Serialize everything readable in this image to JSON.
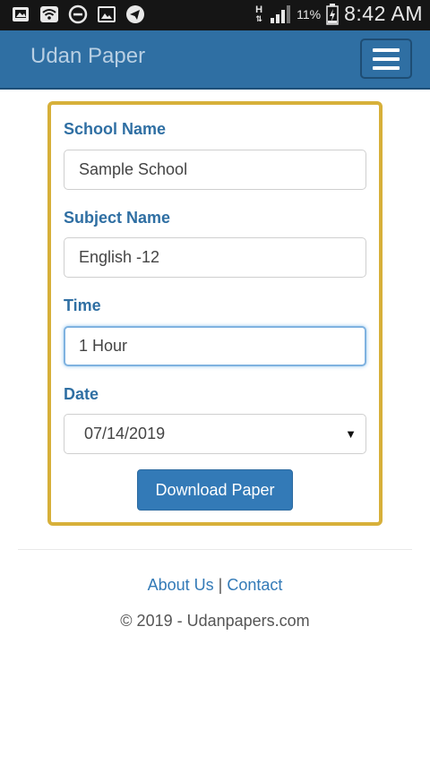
{
  "status_bar": {
    "left_icons": [
      "gallery-notification-icon",
      "wifi-icon",
      "do-not-disturb-icon",
      "image-notification-icon",
      "telegram-icon"
    ],
    "network_type": "H",
    "battery_percent": "11%",
    "clock": "8:42 AM"
  },
  "navbar": {
    "brand": "Udan Paper",
    "menu_icon": "hamburger-menu-icon"
  },
  "form": {
    "school_label": "School Name",
    "school_value": "Sample School",
    "subject_label": "Subject Name",
    "subject_value": "English -12",
    "time_label": "Time",
    "time_value": "1 Hour",
    "date_label": "Date",
    "date_value": "07/14/2019",
    "date_arrow": "▼",
    "download_label": "Download Paper"
  },
  "footer": {
    "about_label": "About Us",
    "separator": "|",
    "contact_label": "Contact",
    "copyright": "© 2019 - Udanpapers.com"
  },
  "colors": {
    "navbar_bg": "#2f6fa3",
    "card_border": "#d7b03a",
    "accent": "#337ab7"
  }
}
